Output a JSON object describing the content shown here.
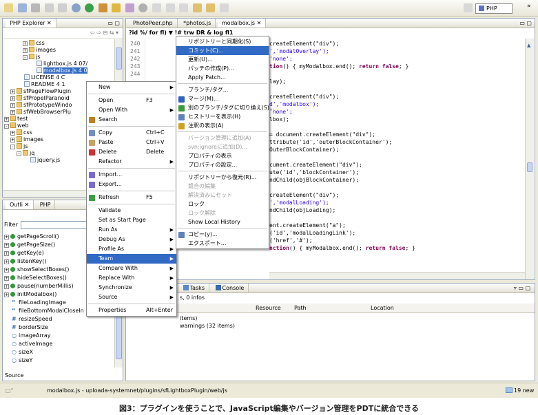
{
  "toolbar": {
    "perspective_label": "PHP"
  },
  "explorer": {
    "tab_label": "PHP Explorer",
    "tree": [
      {
        "label": "css",
        "indent": 3,
        "kind": "folder",
        "exp": "+"
      },
      {
        "label": "images",
        "indent": 3,
        "kind": "folder",
        "exp": "+"
      },
      {
        "label": "js",
        "indent": 3,
        "kind": "folder",
        "exp": "-"
      },
      {
        "label": "lightbox.js 4 07/",
        "indent": 4,
        "kind": "file",
        "exp": ""
      },
      {
        "label": "modalbox.js 4 0",
        "indent": 4,
        "kind": "file",
        "exp": "",
        "selected": true
      },
      {
        "label": "LICENSE 4 C",
        "indent": 2,
        "kind": "file",
        "exp": ""
      },
      {
        "label": "README 4 1",
        "indent": 2,
        "kind": "file",
        "exp": ""
      },
      {
        "label": "sfPageFlowPlugin",
        "indent": 1,
        "kind": "folder",
        "exp": "+"
      },
      {
        "label": "sfPropelParanoid",
        "indent": 1,
        "kind": "folder",
        "exp": "+"
      },
      {
        "label": "sfPrototypeWindo",
        "indent": 1,
        "kind": "folder",
        "exp": "+"
      },
      {
        "label": "sfWebBrowserPlu",
        "indent": 1,
        "kind": "folder",
        "exp": "+"
      },
      {
        "label": "test",
        "indent": 0,
        "kind": "folder",
        "exp": "+"
      },
      {
        "label": "web",
        "indent": 0,
        "kind": "folder",
        "exp": "-"
      },
      {
        "label": "css",
        "indent": 1,
        "kind": "folder",
        "exp": "+"
      },
      {
        "label": "images",
        "indent": 1,
        "kind": "folder",
        "exp": "+"
      },
      {
        "label": "js",
        "indent": 1,
        "kind": "folder",
        "exp": "-"
      },
      {
        "label": "jq",
        "indent": 2,
        "kind": "folder",
        "exp": "-"
      },
      {
        "label": "jquery.js",
        "indent": 3,
        "kind": "file",
        "exp": ""
      }
    ]
  },
  "outline": {
    "tab_outline": "Outli",
    "tab_php": "PHP",
    "filter_label": "Filter",
    "items": [
      {
        "label": "getPageScroll()",
        "kind": "method"
      },
      {
        "label": "getPageSize()",
        "kind": "method"
      },
      {
        "label": "getKey(e)",
        "kind": "method"
      },
      {
        "label": "listenKey()",
        "kind": "method"
      },
      {
        "label": "showSelectBoxes()",
        "kind": "method"
      },
      {
        "label": "hideSelectBoxes()",
        "kind": "method"
      },
      {
        "label": "pause(numberMillis)",
        "kind": "method"
      },
      {
        "label": "initModalbox()",
        "kind": "method"
      },
      {
        "label": "fileLoadingImage",
        "kind": "str"
      },
      {
        "label": "fileBottomModalCloseIn",
        "kind": "str"
      },
      {
        "label": "resizeSpeed",
        "kind": "num"
      },
      {
        "label": "borderSize",
        "kind": "num"
      },
      {
        "label": "imageArray",
        "kind": "obj"
      },
      {
        "label": "activeImage",
        "kind": "obj"
      },
      {
        "label": "sizeX",
        "kind": "obj"
      },
      {
        "label": "sizeY",
        "kind": "obj"
      }
    ],
    "source_label": "Source"
  },
  "editor": {
    "tabs": [
      "PhotoPeer.php",
      "*photos.js",
      "modalbox.js"
    ],
    "breadcrumb": "?id %/ for fl) ▼ !# trw DR & log fl1",
    "line_numbers": [
      "240",
      "241",
      "242",
      "243",
      "244"
    ],
    "code_lines": [
      [
        {
          "t": "createElement(\"div\");"
        }
      ],
      [
        {
          "t": "','modalOverlay');",
          "c": "str"
        }
      ],
      [
        {
          "t": "'none';",
          "c": "str"
        }
      ],
      [
        {
          "t": "tion",
          "c": "kw"
        },
        {
          "t": "() { myModalbox.end(); "
        },
        {
          "t": "return false",
          "c": "kw"
        },
        {
          "t": "; }"
        }
      ],
      [
        {
          "t": ""
        }
      ],
      [
        {
          "t": "lay);"
        }
      ],
      [
        {
          "t": ""
        }
      ],
      [
        {
          "t": "createElement(\"div\");"
        }
      ],
      [
        {
          "t": "d','modalbox');",
          "c": "str"
        }
      ],
      [
        {
          "t": "'none';",
          "c": "str"
        }
      ],
      [
        {
          "t": "lbox);"
        }
      ],
      [
        {
          "t": ""
        }
      ],
      [
        {
          "t": "= document.createElement(\"div\");"
        }
      ],
      [
        {
          "t": "ttribute('id','outerBlockContainer');"
        }
      ],
      [
        {
          "t": "OuterBlockContainer);"
        }
      ],
      [
        {
          "t": ""
        }
      ],
      [
        {
          "t": "cument.createElement(\"div\");"
        }
      ],
      [
        {
          "t": "ute('id','blockContainer');"
        }
      ],
      [
        {
          "t": "ndChild(objBlockContainer);"
        }
      ],
      [
        {
          "t": ""
        }
      ],
      [
        {
          "t": "createElement(\"div\");"
        }
      ],
      [
        {
          "t": "','modalLoading');",
          "c": "str"
        }
      ],
      [
        {
          "t": "ndChild(objLoading);"
        }
      ],
      [
        {
          "t": ""
        }
      ],
      [
        {
          "t": "ent.createElement(\"a\");"
        }
      ],
      [
        {
          "t": "('id','modalLoadingLink');"
        }
      ],
      [
        {
          "t": "('href','#');"
        }
      ],
      [
        {
          "t": "nction",
          "c": "kw"
        },
        {
          "t": "() { myModalbox.end(); "
        },
        {
          "t": "return false",
          "c": "kw"
        },
        {
          "t": "; }"
        }
      ]
    ]
  },
  "bottom": {
    "tab_tasks": "Tasks",
    "tab_console": "Console",
    "summary": "s, 0 infos",
    "columns": [
      "Resource",
      "Path",
      "Location"
    ],
    "rows": [
      "items)",
      "warnings (32 items)"
    ]
  },
  "context_menu": [
    {
      "label": "New",
      "arrow": true
    },
    {
      "sep": true
    },
    {
      "label": "Open",
      "accel": "F3"
    },
    {
      "label": "Open With",
      "arrow": true
    },
    {
      "label": "Search",
      "icon": "#c08020"
    },
    {
      "sep": true
    },
    {
      "label": "Copy",
      "accel": "Ctrl+C",
      "icon": "#6e8fc8"
    },
    {
      "label": "Paste",
      "accel": "Ctrl+V",
      "icon": "#c8a060"
    },
    {
      "label": "Delete",
      "accel": "Delete",
      "icon": "#d03030"
    },
    {
      "label": "Refactor",
      "arrow": true
    },
    {
      "sep": true
    },
    {
      "label": "Import...",
      "icon": "#7a6ad0"
    },
    {
      "label": "Export...",
      "icon": "#7a6ad0"
    },
    {
      "sep": true
    },
    {
      "label": "Refresh",
      "accel": "F5",
      "icon": "#3aa040"
    },
    {
      "sep": true
    },
    {
      "label": "Validate"
    },
    {
      "label": "Set as Start Page"
    },
    {
      "label": "Run As",
      "arrow": true
    },
    {
      "label": "Debug As",
      "arrow": true
    },
    {
      "label": "Profile As",
      "arrow": true
    },
    {
      "label": "Team",
      "arrow": true,
      "selected": true
    },
    {
      "label": "Compare With",
      "arrow": true
    },
    {
      "label": "Replace With",
      "arrow": true
    },
    {
      "label": "Synchronize",
      "arrow": true
    },
    {
      "label": "Source",
      "arrow": true
    },
    {
      "sep": true
    },
    {
      "label": "Properties",
      "accel": "Alt+Enter"
    }
  ],
  "team_menu": [
    {
      "label": "リポジトリーと同期化(S)"
    },
    {
      "label": "コミット(C)...",
      "selected": true
    },
    {
      "label": "更新(U)..."
    },
    {
      "label": "パッチの作成(P)..."
    },
    {
      "label": "Apply Patch..."
    },
    {
      "sep": true
    },
    {
      "label": "ブランチ/タグ..."
    },
    {
      "label": "マージ(M)...",
      "icon": "#3060c0"
    },
    {
      "label": "別のブランチ/タグに切り換え(S)...",
      "icon": "#3a9a3a"
    },
    {
      "label": "ヒストリーを表示(H)",
      "icon": "#6080c0"
    },
    {
      "label": "注釈の表示(A)",
      "icon": "#d0a020"
    },
    {
      "sep": true
    },
    {
      "label": "バージョン管理に追加(A)",
      "disabled": true
    },
    {
      "label": "svn:ignoreに追加(D)...",
      "disabled": true
    },
    {
      "label": "プロパティの表示"
    },
    {
      "label": "プロパティの設定..."
    },
    {
      "sep": true
    },
    {
      "label": "リポジトリーから復元(R)..."
    },
    {
      "label": "競合の編集",
      "disabled": true
    },
    {
      "label": "解決済みにセット",
      "disabled": true
    },
    {
      "label": "ロック"
    },
    {
      "label": "ロック解除",
      "disabled": true
    },
    {
      "label": "Show Local History"
    },
    {
      "sep": true
    },
    {
      "label": "コピー(y)...",
      "icon": "#6080c0"
    },
    {
      "label": "エクスポート..."
    }
  ],
  "status": {
    "path": "modalbox.js - uploada-systemnet/plugins/sfLightboxPlugin/web/js",
    "new_count": "19 new"
  },
  "caption": "図3：プラグインを使うことで、JavaScript編集やバージョン管理をPDTに統合できる"
}
